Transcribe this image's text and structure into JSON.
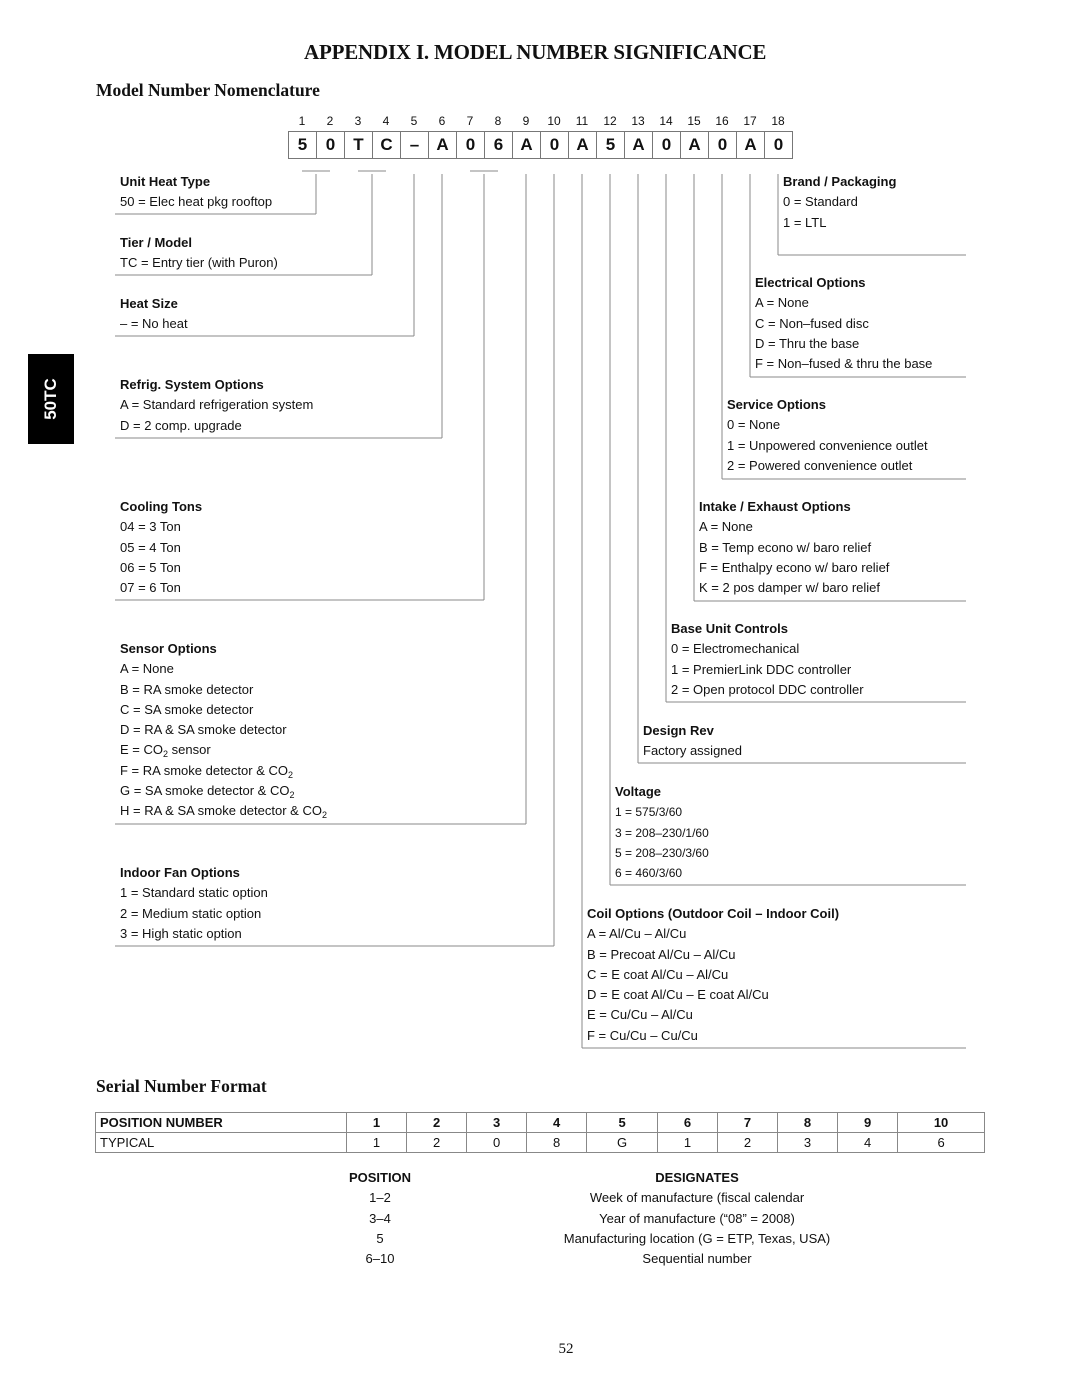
{
  "page": {
    "title": "APPENDIX I. MODEL NUMBER SIGNIFICANCE",
    "side_tab": "50TC",
    "page_number": "52"
  },
  "nomenclature": {
    "section_title": "Model Number Nomenclature",
    "positions": [
      "1",
      "2",
      "3",
      "4",
      "5",
      "6",
      "7",
      "8",
      "9",
      "10",
      "11",
      "12",
      "13",
      "14",
      "15",
      "16",
      "17",
      "18"
    ],
    "model_chars": [
      "5",
      "0",
      "T",
      "C",
      "–",
      "A",
      "0",
      "6",
      "A",
      "0",
      "A",
      "5",
      "A",
      "0",
      "A",
      "0",
      "A",
      "0"
    ],
    "left_groups": [
      {
        "heading": "Unit Heat Type",
        "items": [
          "50 = Elec heat pkg rooftop"
        ]
      },
      {
        "heading": "Tier / Model",
        "items": [
          "TC = Entry tier (with Puron)"
        ]
      },
      {
        "heading": "Heat Size",
        "items": [
          "– = No heat"
        ]
      },
      {
        "heading": "Refrig. System Options",
        "items": [
          "A = Standard refrigeration system",
          "D = 2 comp. upgrade"
        ]
      },
      {
        "heading": "Cooling Tons",
        "items": [
          "04 = 3 Ton",
          "05 = 4 Ton",
          "06 = 5 Ton",
          "07 = 6 Ton"
        ]
      },
      {
        "heading": "Sensor Options",
        "items": [
          "A = None",
          "B = RA smoke detector",
          "C = SA smoke detector",
          "D = RA & SA smoke detector",
          "E = CO2 sensor",
          "F = RA smoke detector & CO2",
          "G = SA smoke detector & CO2",
          "H = RA & SA smoke detector & CO2"
        ]
      },
      {
        "heading": "Indoor Fan Options",
        "items": [
          "1 = Standard static option",
          "2 = Medium static option",
          "3 = High static option"
        ]
      }
    ],
    "right_groups": [
      {
        "heading": "Brand / Packaging",
        "items": [
          "0 = Standard",
          "1 = LTL"
        ]
      },
      {
        "heading": "Electrical Options",
        "items": [
          "A = None",
          "C = Non–fused disc",
          "D = Thru the base",
          "F = Non–fused & thru the base"
        ]
      },
      {
        "heading": "Service Options",
        "items": [
          "0 = None",
          "1 = Unpowered convenience outlet",
          "2 = Powered convenience outlet"
        ]
      },
      {
        "heading": "Intake / Exhaust Options",
        "items": [
          "A = None",
          "B = Temp econo w/ baro relief",
          "F = Enthalpy econo w/ baro relief",
          "K = 2 pos damper w/ baro relief"
        ]
      },
      {
        "heading": "Base Unit Controls",
        "items": [
          "0 = Electromechanical",
          "1 = PremierLink DDC controller",
          "2 = Open protocol DDC controller"
        ]
      },
      {
        "heading": "Design Rev",
        "items": [
          "Factory assigned"
        ]
      },
      {
        "heading": "Voltage",
        "items": [
          "1 = 575/3/60",
          "3 = 208–230/1/60",
          "5 = 208–230/3/60",
          "6 = 460/3/60"
        ]
      },
      {
        "heading": "Coil Options (Outdoor Coil – Indoor Coil)",
        "items": [
          "A = Al/Cu – Al/Cu",
          "B = Precoat Al/Cu – Al/Cu",
          "C = E coat Al/Cu – Al/Cu",
          "D = E coat Al/Cu – E coat Al/Cu",
          "E = Cu/Cu – Al/Cu",
          "F = Cu/Cu – Cu/Cu"
        ]
      }
    ]
  },
  "serial": {
    "section_title": "Serial Number Format",
    "table": {
      "header_label": "POSITION NUMBER",
      "positions": [
        "1",
        "2",
        "3",
        "4",
        "5",
        "6",
        "7",
        "8",
        "9",
        "10"
      ],
      "row_label": "TYPICAL",
      "typical": [
        "1",
        "2",
        "0",
        "8",
        "G",
        "1",
        "2",
        "3",
        "4",
        "6"
      ]
    },
    "designations": {
      "position_header": "POSITION",
      "designates_header": "DESIGNATES",
      "rows": [
        {
          "position": "1–2",
          "designates": "Week of manufacture (fiscal calendar"
        },
        {
          "position": "3–4",
          "designates": "Year of manufacture (“08” = 2008)"
        },
        {
          "position": "5",
          "designates": "Manufacturing location (G = ETP, Texas, USA)"
        },
        {
          "position": "6–10",
          "designates": "Sequential number"
        }
      ]
    }
  }
}
